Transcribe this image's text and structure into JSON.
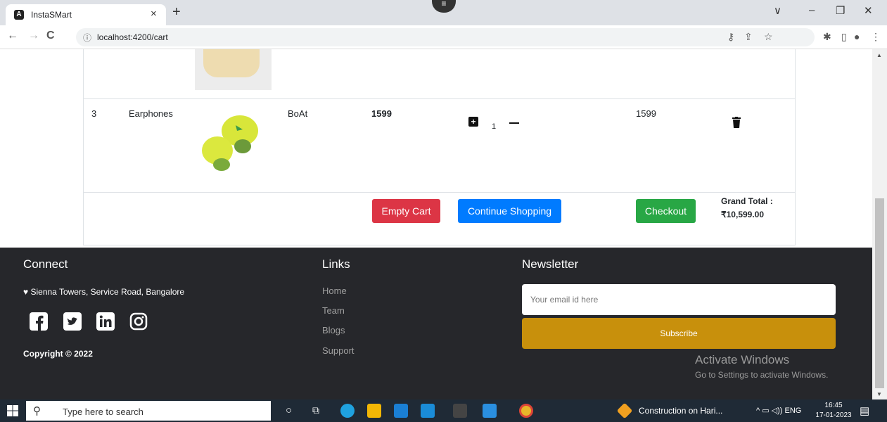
{
  "browser": {
    "tab_title": "InstaSMart",
    "tab_close": "×",
    "new_tab": "+",
    "url": "localhost:4200/cart",
    "back": "←",
    "forward": "→",
    "reload": "C",
    "info": "ⓘ",
    "minimize": "–",
    "restore": "❐",
    "close": "✕",
    "dropdown": "∨"
  },
  "cart": {
    "row": {
      "index": "3",
      "name": "Earphones",
      "brand": "BoAt",
      "price": "1599",
      "plus": "+",
      "quantity": "1",
      "total": "1599"
    },
    "empty_cart_label": "Empty Cart",
    "continue_label": "Continue Shopping",
    "checkout_label": "Checkout",
    "grand_total_label": "Grand Total :",
    "grand_total_value": "₹10,599.00"
  },
  "footer": {
    "connect_title": "Connect",
    "address": "Sienna Towers, Service Road, Bangalore",
    "copyright": "Copyright © 2022",
    "links_title": "Links",
    "links": [
      "Home",
      "Team",
      "Blogs",
      "Support"
    ],
    "newsletter_title": "Newsletter",
    "email_placeholder": "Your email id here",
    "subscribe_label": "Subscribe",
    "activate_title": "Activate Windows",
    "activate_sub": "Go to Settings to activate Windows."
  },
  "taskbar": {
    "search_placeholder": "Type here to search",
    "tray_text": "Construction on Hari...",
    "tray_lang": "ENG",
    "time": "16:45",
    "date": "17-01-2023"
  },
  "colors": {
    "danger": "#dc3545",
    "primary": "#007bff",
    "success": "#28a745",
    "footer_bg": "#26272b",
    "subscribe": "#c8900c"
  }
}
